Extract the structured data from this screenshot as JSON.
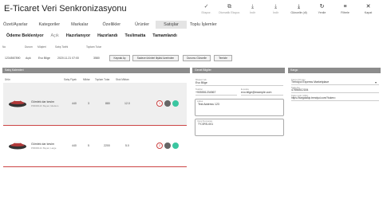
{
  "app": {
    "title": "E-Ticaret Veri Senkronizasyonu"
  },
  "toolbar": [
    {
      "label": "Ekspor.",
      "icon": "✓",
      "icon_name": "check-icon",
      "active": false
    },
    {
      "label": "Otomatik Ekspor.",
      "icon": "⧉",
      "icon_name": "copy-icon",
      "active": false
    },
    {
      "label": "İndir",
      "icon": "⤓",
      "icon_name": "download-icon",
      "active": false
    },
    {
      "label": "İndir",
      "icon": "⤓",
      "icon_name": "download-icon",
      "active": false
    },
    {
      "label": "Güncelle (dl)",
      "icon": "⤓",
      "icon_name": "update-download-icon",
      "active": true
    },
    {
      "label": "Yenile",
      "icon": "↻",
      "icon_name": "refresh-icon",
      "active": true
    },
    {
      "label": "Filtrele",
      "icon": "≡",
      "icon_name": "filter-icon",
      "active": true
    },
    {
      "label": "Kapat",
      "icon": "✕",
      "icon_name": "close-icon",
      "active": true
    }
  ],
  "tabs": [
    {
      "label": "Özet/Ayarlar",
      "selected": false
    },
    {
      "label": "Kategoriler",
      "selected": false
    },
    {
      "label": "Markalar",
      "selected": false
    },
    {
      "label": "Özellikler",
      "selected": false
    },
    {
      "label": "Ürünler",
      "selected": false
    },
    {
      "label": "Satışlar",
      "selected": true
    },
    {
      "label": "Toplu İşlemler",
      "selected": false
    }
  ],
  "subtabs": [
    {
      "label": "Ödeme Bekleniyor",
      "light": false
    },
    {
      "label": "Açık",
      "light": true
    },
    {
      "label": "Hazırlanıyor",
      "light": false
    },
    {
      "label": "Hazırlandı",
      "light": false
    },
    {
      "label": "Teslimatta",
      "light": false
    },
    {
      "label": "Tamamlandı",
      "light": false
    }
  ],
  "filters": {
    "headers": [
      "No",
      "Durum",
      "Müşteri",
      "Satış Tarihi",
      "Toplam Tutar"
    ],
    "values": {
      "no": "1234567890",
      "status": "Açık",
      "customer": "Evo Bilge",
      "date": "2020.11.21 07:00",
      "total": "3580"
    },
    "buttons": [
      "Kaynak Aç",
      "Sadece ürünleri ilişkisi üzerinden",
      "Durumu Güncelle",
      "Temizle"
    ]
  },
  "panels": {
    "details": "Satış Kalemleri",
    "customer": "Genel Bilgiler",
    "cargo": "Kargo"
  },
  "columns": [
    "Ürün",
    "Satış Fiyatı",
    "Miktar",
    "Toplam Tutar",
    "Stok Miktarı"
  ],
  "products": [
    {
      "name": "Gömlek dar kesim",
      "sub1": "PRD00123",
      "sub2": "Beyaz, Medium",
      "price": "440",
      "qty": "3",
      "total": "880",
      "stock": "12.0"
    },
    {
      "name": "Gömlek dar kesim",
      "sub1": "PRD00124",
      "sub2": "Beyaz, Large",
      "price": "440",
      "qty": "5",
      "total": "2200",
      "stock": "5.0"
    }
  ],
  "customer": {
    "name_label": "Müşteri Adı",
    "name": "Evo Bilge",
    "phone_label": "Telefon",
    "phone": "+905551234567",
    "email_label": "E-posta",
    "email": "evo.bilge@example.com",
    "address_label": "Adres",
    "address": "Test Address 123",
    "tax_label": "Vergi Numarası",
    "tax": "TY-0RS-001"
  },
  "cargo": {
    "company_label": "Kargo Firması",
    "company": "Trendyol Express Marketplace",
    "tracking_label": "Takip No",
    "tracking": "47856512184",
    "url_label": "Takip Linki (URL)",
    "url": "https://kargotakip.trendyol.com/?token="
  },
  "colors": {
    "accent_red": "#c44a4a",
    "teal": "#3ac6a0",
    "gray_btn": "#666666"
  }
}
